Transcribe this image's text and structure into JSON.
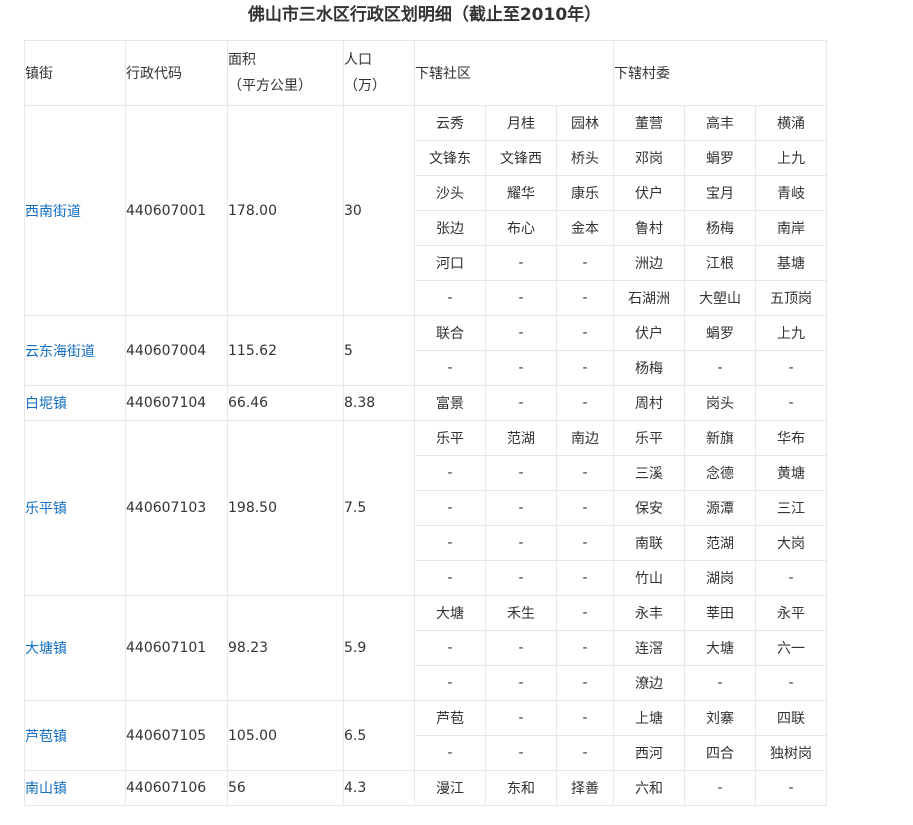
{
  "title": "佛山市三水区行政区划明细（截止至2010年）",
  "headers": {
    "town": "镇街",
    "code": "行政代码",
    "area_line1": "面积",
    "area_line2": "（平方公里）",
    "pop_line1": "人口",
    "pop_line2": "（万）",
    "communities": "下辖社区",
    "villages": "下辖村委"
  },
  "towns": [
    {
      "name": "西南街道",
      "code": "440607001",
      "area": "178.00",
      "population": "30",
      "rows": [
        {
          "communities": [
            "云秀",
            "月桂",
            "园林"
          ],
          "villages": [
            "董营",
            "高丰",
            "横涌"
          ]
        },
        {
          "communities": [
            "文锋东",
            "文锋西",
            "桥头"
          ],
          "villages": [
            "邓岗",
            "蜎罗",
            "上九"
          ]
        },
        {
          "communities": [
            "沙头",
            "耀华",
            "康乐"
          ],
          "villages": [
            "伏户",
            "宝月",
            "青岐"
          ]
        },
        {
          "communities": [
            "张边",
            "布心",
            "金本"
          ],
          "villages": [
            "鲁村",
            "杨梅",
            "南岸"
          ]
        },
        {
          "communities": [
            "河口",
            "-",
            "-"
          ],
          "villages": [
            "洲边",
            "江根",
            "基塘"
          ]
        },
        {
          "communities": [
            "-",
            "-",
            "-"
          ],
          "villages": [
            "石湖洲",
            "大塱山",
            "五顶岗"
          ]
        }
      ]
    },
    {
      "name": "云东海街道",
      "code": "440607004",
      "area": "115.62",
      "population": "5",
      "rows": [
        {
          "communities": [
            "联合",
            "-",
            "-"
          ],
          "villages": [
            "伏户",
            "蜎罗",
            "上九"
          ]
        },
        {
          "communities": [
            "-",
            "-",
            "-"
          ],
          "villages": [
            "杨梅",
            "-",
            "-"
          ]
        }
      ]
    },
    {
      "name": "白坭镇",
      "code": "440607104",
      "area": "66.46",
      "population": "8.38",
      "rows": [
        {
          "communities": [
            "富景",
            "-",
            "-"
          ],
          "villages": [
            "周村",
            "岗头",
            "-"
          ]
        }
      ]
    },
    {
      "name": "乐平镇",
      "code": "440607103",
      "area": "198.50",
      "population": "7.5",
      "rows": [
        {
          "communities": [
            "乐平",
            "范湖",
            "南边"
          ],
          "villages": [
            "乐平",
            "新旗",
            "华布"
          ]
        },
        {
          "communities": [
            "-",
            "-",
            "-"
          ],
          "villages": [
            "三溪",
            "念德",
            "黄塘"
          ]
        },
        {
          "communities": [
            "-",
            "-",
            "-"
          ],
          "villages": [
            "保安",
            "源潭",
            "三江"
          ]
        },
        {
          "communities": [
            "-",
            "-",
            "-"
          ],
          "villages": [
            "南联",
            "范湖",
            "大岗"
          ]
        },
        {
          "communities": [
            "-",
            "-",
            "-"
          ],
          "villages": [
            "竹山",
            "湖岗",
            "-"
          ]
        }
      ]
    },
    {
      "name": "大塘镇",
      "code": "440607101",
      "area": "98.23",
      "population": "5.9",
      "rows": [
        {
          "communities": [
            "大塘",
            "禾生",
            "-"
          ],
          "villages": [
            "永丰",
            "莘田",
            "永平"
          ]
        },
        {
          "communities": [
            "-",
            "-",
            "-"
          ],
          "villages": [
            "连滘",
            "大塘",
            "六一"
          ]
        },
        {
          "communities": [
            "-",
            "-",
            "-"
          ],
          "villages": [
            "潦边",
            "-",
            "-"
          ]
        }
      ]
    },
    {
      "name": "芦苞镇",
      "code": "440607105",
      "area": "105.00",
      "population": "6.5",
      "rows": [
        {
          "communities": [
            "芦苞",
            "-",
            "-"
          ],
          "villages": [
            "上塘",
            "刘寨",
            "四联"
          ]
        },
        {
          "communities": [
            "-",
            "-",
            "-"
          ],
          "villages": [
            "西河",
            "四合",
            "独树岗"
          ]
        }
      ]
    },
    {
      "name": "南山镇",
      "code": "440607106",
      "area": "56",
      "population": "4.3",
      "rows": [
        {
          "communities": [
            "漫江",
            "东和",
            "择善"
          ],
          "villages": [
            "六和",
            "-",
            "-"
          ]
        }
      ]
    }
  ]
}
